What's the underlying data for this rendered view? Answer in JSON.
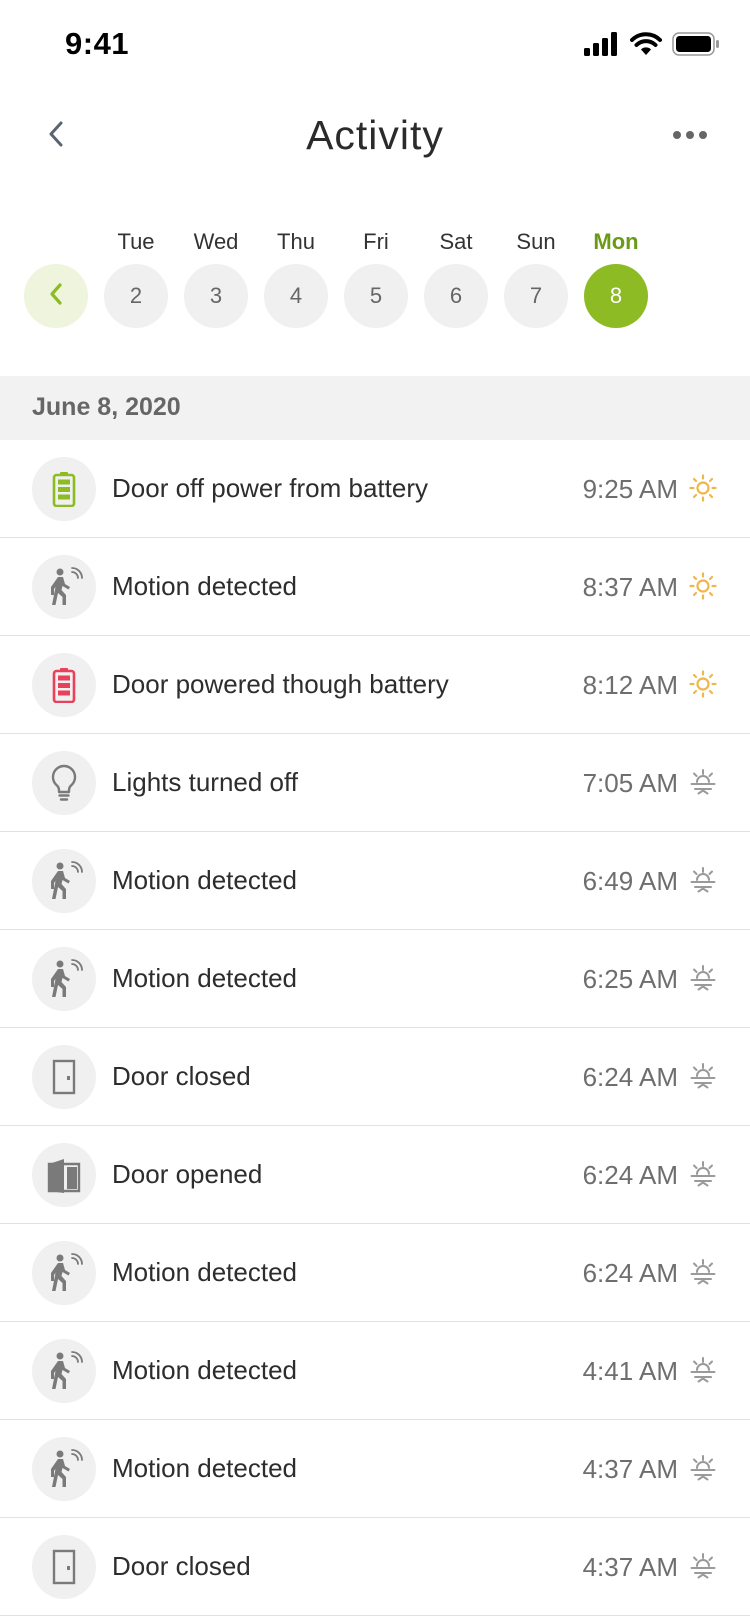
{
  "status_bar": {
    "time": "9:41"
  },
  "header": {
    "title": "Activity"
  },
  "date_selector": {
    "days": [
      {
        "name": "Tue",
        "number": "2",
        "selected": false
      },
      {
        "name": "Wed",
        "number": "3",
        "selected": false
      },
      {
        "name": "Thu",
        "number": "4",
        "selected": false
      },
      {
        "name": "Fri",
        "number": "5",
        "selected": false
      },
      {
        "name": "Sat",
        "number": "6",
        "selected": false
      },
      {
        "name": "Sun",
        "number": "7",
        "selected": false
      },
      {
        "name": "Mon",
        "number": "8",
        "selected": true
      }
    ]
  },
  "section": {
    "date": "June 8, 2020"
  },
  "colors": {
    "accent": "#8dbb24",
    "accent_text": "#6a9a16",
    "battery_full": "#8dbb24",
    "battery_low": "#e8425a",
    "sun": "#f0b64a",
    "night": "#9a9a9a",
    "icon_gray": "#7a7a7a"
  },
  "activities": [
    {
      "icon": "battery-full-icon",
      "label": "Door off power from battery",
      "time": "9:25 AM",
      "weather": "sun-icon"
    },
    {
      "icon": "motion-icon",
      "label": "Motion detected",
      "time": "8:37 AM",
      "weather": "sun-icon"
    },
    {
      "icon": "battery-low-icon",
      "label": "Door powered though battery",
      "time": "8:12 AM",
      "weather": "sun-icon"
    },
    {
      "icon": "lightbulb-icon",
      "label": "Lights turned off",
      "time": "7:05 AM",
      "weather": "night-icon"
    },
    {
      "icon": "motion-icon",
      "label": "Motion detected",
      "time": "6:49 AM",
      "weather": "night-icon"
    },
    {
      "icon": "motion-icon",
      "label": "Motion detected",
      "time": "6:25 AM",
      "weather": "night-icon"
    },
    {
      "icon": "door-closed-icon",
      "label": "Door closed",
      "time": "6:24 AM",
      "weather": "night-icon"
    },
    {
      "icon": "door-opened-icon",
      "label": "Door opened",
      "time": "6:24 AM",
      "weather": "night-icon"
    },
    {
      "icon": "motion-icon",
      "label": "Motion detected",
      "time": "6:24 AM",
      "weather": "night-icon"
    },
    {
      "icon": "motion-icon",
      "label": "Motion detected",
      "time": "4:41 AM",
      "weather": "night-icon"
    },
    {
      "icon": "motion-icon",
      "label": "Motion detected",
      "time": "4:37 AM",
      "weather": "night-icon"
    },
    {
      "icon": "door-closed-icon",
      "label": "Door closed",
      "time": "4:37 AM",
      "weather": "night-icon"
    }
  ]
}
